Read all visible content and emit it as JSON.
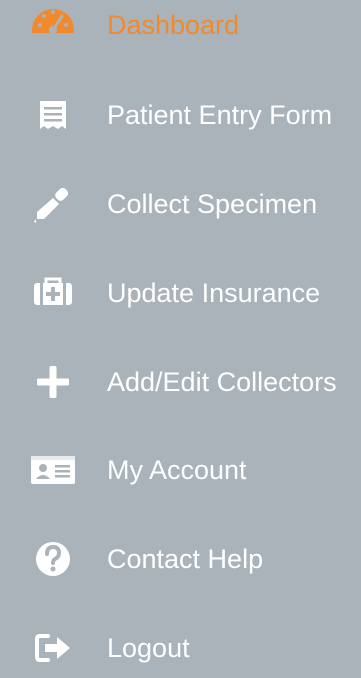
{
  "sidebar": {
    "active_color": "#f08a2c",
    "text_color": "#ffffff",
    "background": "#aab3ba",
    "items": [
      {
        "label": "Dashboard",
        "icon": "tachometer-icon",
        "active": true
      },
      {
        "label": "Patient Entry Form",
        "icon": "receipt-icon",
        "active": false
      },
      {
        "label": "Collect Specimen",
        "icon": "eyedropper-icon",
        "active": false
      },
      {
        "label": "Update Insurance",
        "icon": "medkit-icon",
        "active": false
      },
      {
        "label": "Add/Edit Collectors",
        "icon": "plus-icon",
        "active": false
      },
      {
        "label": "My Account",
        "icon": "id-card-icon",
        "active": false
      },
      {
        "label": "Contact Help",
        "icon": "question-circle-icon",
        "active": false
      },
      {
        "label": "Logout",
        "icon": "sign-out-icon",
        "active": false
      }
    ]
  }
}
